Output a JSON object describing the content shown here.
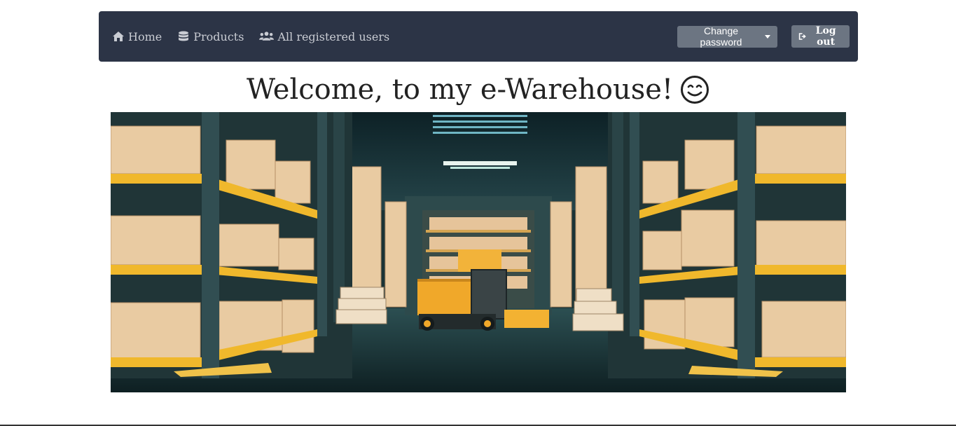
{
  "nav": {
    "links": [
      {
        "label": "Home",
        "icon": "home-icon"
      },
      {
        "label": "Products",
        "icon": "database-icon"
      },
      {
        "label": "All registered users",
        "icon": "users-icon"
      }
    ],
    "change_password_label": "Change password",
    "logout_label": "Log out"
  },
  "main": {
    "welcome_text": "Welcome, to my e-Warehouse!",
    "emoji": "smiling-face-icon",
    "hero_image": "warehouse-illustration"
  },
  "colors": {
    "navbar": "#2c3446",
    "button": "#6c7582",
    "shelf": "#f0b82c",
    "box": "#e8c9a0"
  }
}
